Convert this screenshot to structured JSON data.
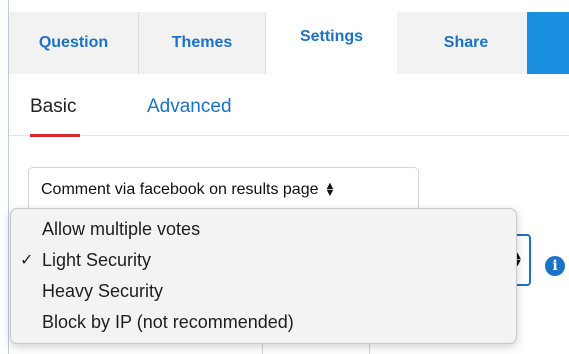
{
  "tabs": [
    {
      "label": "Question",
      "active": false
    },
    {
      "label": "Themes",
      "active": false
    },
    {
      "label": "Settings",
      "active": true
    },
    {
      "label": "Share",
      "active": false
    }
  ],
  "subtabs": [
    {
      "label": "Basic",
      "active": true
    },
    {
      "label": "Advanced",
      "active": false
    }
  ],
  "comment_select": {
    "value": "Comment via facebook on results page"
  },
  "vote_dropdown": {
    "options": [
      {
        "label": "Allow multiple votes",
        "selected": false
      },
      {
        "label": "Light Security",
        "selected": true
      },
      {
        "label": "Heavy Security",
        "selected": false
      },
      {
        "label": "Block by IP (not recommended)",
        "selected": false
      }
    ],
    "check_glyph": "✓"
  },
  "colors": {
    "accent": "#1a73c8",
    "underline": "#d62b2b",
    "tab_bg": "#f2f2f2"
  },
  "icons": {
    "info": "info-icon"
  }
}
